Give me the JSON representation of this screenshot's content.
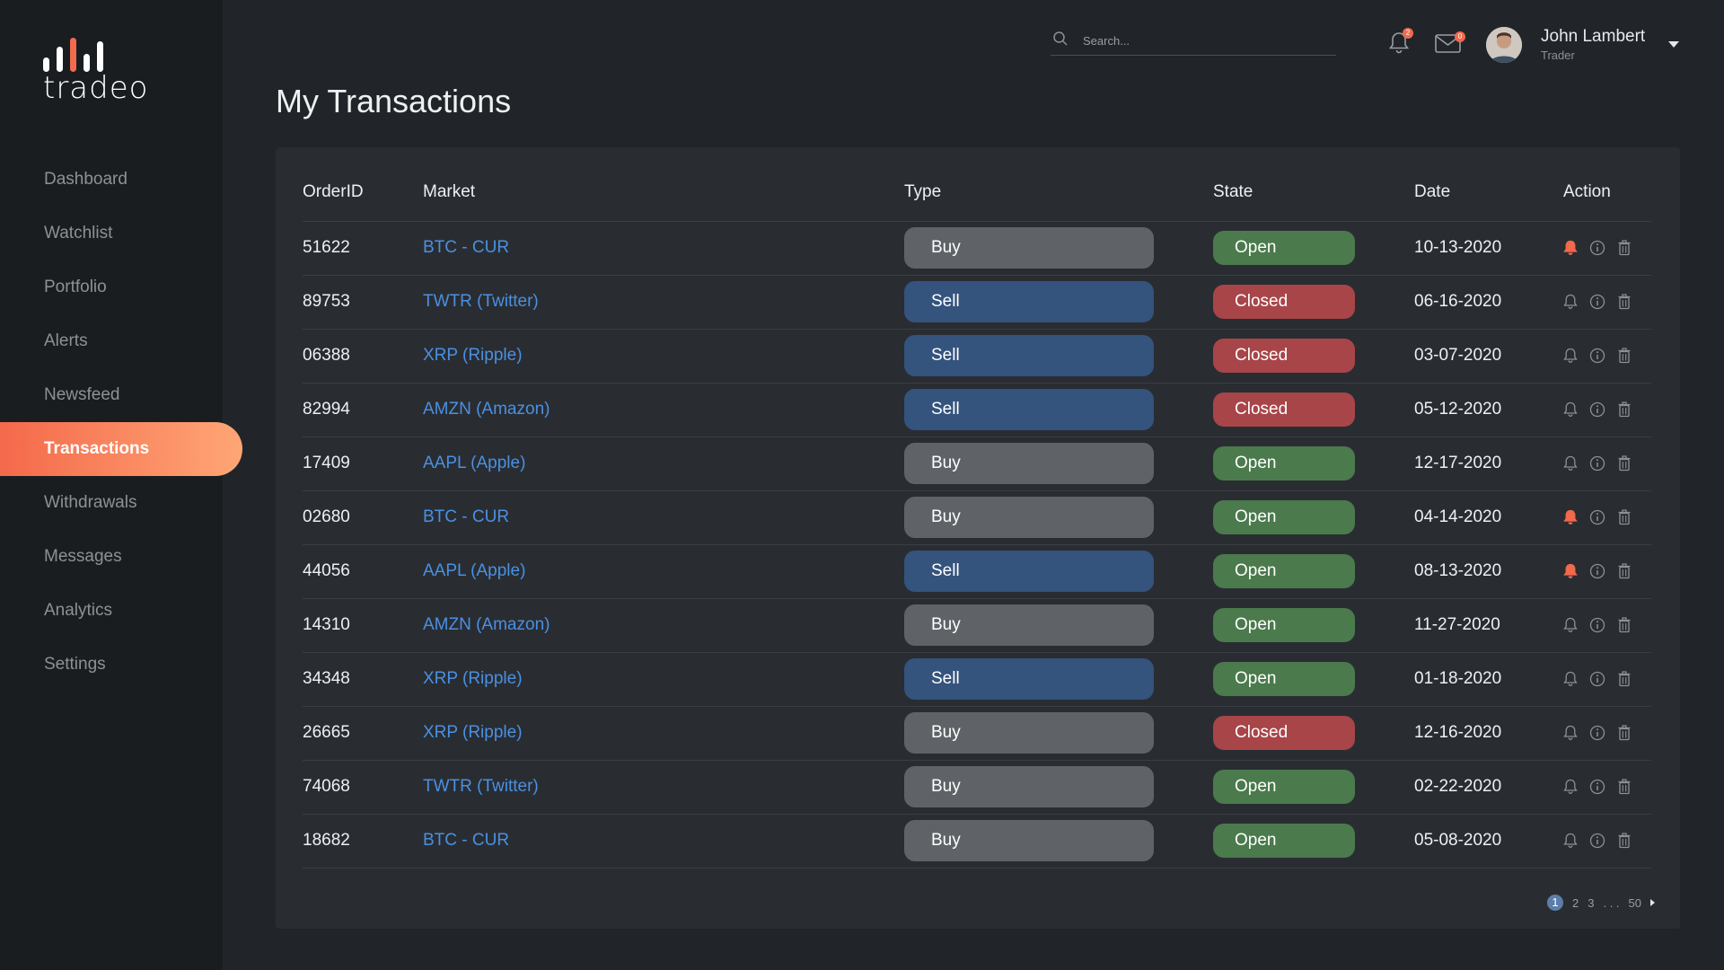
{
  "brand": {
    "name": "tradeo"
  },
  "colors": {
    "accent": "#f26b4e",
    "link": "#4a90e2",
    "open": "#4b7a4d",
    "closed": "#a84549",
    "buy": "#5f6368",
    "sell": "#34537d"
  },
  "nav": {
    "items": [
      {
        "label": "Dashboard"
      },
      {
        "label": "Watchlist"
      },
      {
        "label": "Portfolio"
      },
      {
        "label": "Alerts"
      },
      {
        "label": "Newsfeed"
      },
      {
        "label": "Transactions",
        "active": true
      },
      {
        "label": "Withdrawals"
      },
      {
        "label": "Messages"
      },
      {
        "label": "Analytics"
      },
      {
        "label": "Settings"
      }
    ]
  },
  "header": {
    "search_placeholder": "Search...",
    "notifications_badge": "2",
    "messages_badge": "0",
    "user": {
      "name": "John Lambert",
      "role": "Trader"
    }
  },
  "page": {
    "title": "My Transactions"
  },
  "table": {
    "columns": [
      "OrderID",
      "Market",
      "Type",
      "State",
      "Date",
      "Action"
    ],
    "rows": [
      {
        "order_id": "51622",
        "market": "BTC - CUR",
        "type": "Buy",
        "state": "Open",
        "date": "10-13-2020",
        "alert_active": true
      },
      {
        "order_id": "89753",
        "market": "TWTR (Twitter)",
        "type": "Sell",
        "state": "Closed",
        "date": "06-16-2020",
        "alert_active": false
      },
      {
        "order_id": "06388",
        "market": "XRP (Ripple)",
        "type": "Sell",
        "state": "Closed",
        "date": "03-07-2020",
        "alert_active": false
      },
      {
        "order_id": "82994",
        "market": "AMZN (Amazon)",
        "type": "Sell",
        "state": "Closed",
        "date": "05-12-2020",
        "alert_active": false
      },
      {
        "order_id": "17409",
        "market": "AAPL (Apple)",
        "type": "Buy",
        "state": "Open",
        "date": "12-17-2020",
        "alert_active": false
      },
      {
        "order_id": "02680",
        "market": "BTC - CUR",
        "type": "Buy",
        "state": "Open",
        "date": "04-14-2020",
        "alert_active": true
      },
      {
        "order_id": "44056",
        "market": "AAPL (Apple)",
        "type": "Sell",
        "state": "Open",
        "date": "08-13-2020",
        "alert_active": true
      },
      {
        "order_id": "14310",
        "market": "AMZN (Amazon)",
        "type": "Buy",
        "state": "Open",
        "date": "11-27-2020",
        "alert_active": false
      },
      {
        "order_id": "34348",
        "market": "XRP (Ripple)",
        "type": "Sell",
        "state": "Open",
        "date": "01-18-2020",
        "alert_active": false
      },
      {
        "order_id": "26665",
        "market": "XRP (Ripple)",
        "type": "Buy",
        "state": "Closed",
        "date": "12-16-2020",
        "alert_active": false
      },
      {
        "order_id": "74068",
        "market": "TWTR (Twitter)",
        "type": "Buy",
        "state": "Open",
        "date": "02-22-2020",
        "alert_active": false
      },
      {
        "order_id": "18682",
        "market": "BTC - CUR",
        "type": "Buy",
        "state": "Open",
        "date": "05-08-2020",
        "alert_active": false
      }
    ]
  },
  "pagination": {
    "pages": [
      "1",
      "2",
      "3"
    ],
    "ellipsis": ". . .",
    "last": "50",
    "current": "1"
  }
}
